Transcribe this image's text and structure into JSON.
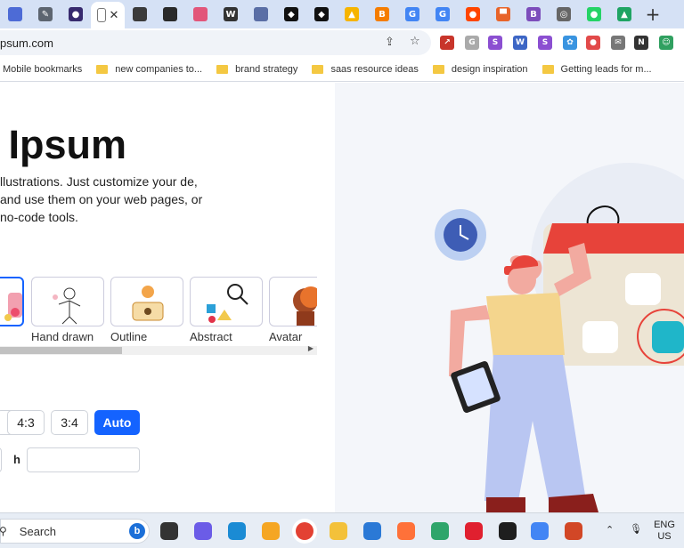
{
  "browser": {
    "tabs": [
      {
        "icon": "profile-icon",
        "color": "#4d6bd6",
        "glyph": ""
      },
      {
        "icon": "feather-icon",
        "color": "#5d6570",
        "glyph": "✎"
      },
      {
        "icon": "circle-avatar-icon",
        "color": "#372a6e",
        "glyph": "●"
      },
      {
        "icon": "doc-icon",
        "color": "#ffffff",
        "glyph": "",
        "active": true
      },
      {
        "icon": "avatar-icon",
        "color": "#3b3b3b",
        "glyph": ""
      },
      {
        "icon": "avatar-icon",
        "color": "#2a2a2a",
        "glyph": ""
      },
      {
        "icon": "monster-icon",
        "color": "#e2567a",
        "glyph": ""
      },
      {
        "icon": "wix-icon",
        "color": "#333333",
        "glyph": "W"
      },
      {
        "icon": "printer-icon",
        "color": "#5a6ea5",
        "glyph": ""
      },
      {
        "icon": "diamond-icon",
        "color": "#111111",
        "glyph": "◆"
      },
      {
        "icon": "diamond-icon",
        "color": "#111111",
        "glyph": "◆"
      },
      {
        "icon": "google-ads-icon",
        "color": "#f6b400",
        "glyph": "▲"
      },
      {
        "icon": "blogger-icon",
        "color": "#f57d00",
        "glyph": "B"
      },
      {
        "icon": "google-icon",
        "color": "#4285f4",
        "glyph": "G"
      },
      {
        "icon": "google-icon",
        "color": "#4285f4",
        "glyph": "G"
      },
      {
        "icon": "reddit-icon",
        "color": "#ff4500",
        "glyph": "●"
      },
      {
        "icon": "bookmark-orange-icon",
        "color": "#e8642a",
        "glyph": "▀"
      },
      {
        "icon": "bolt-icon",
        "color": "#7c4dbb",
        "glyph": "B"
      },
      {
        "icon": "chrome-icon",
        "color": "#666666",
        "glyph": "◎"
      },
      {
        "icon": "whatsapp-icon",
        "color": "#25d366",
        "glyph": "●"
      },
      {
        "icon": "drive-icon",
        "color": "#1fa463",
        "glyph": "▲"
      }
    ],
    "tab_close": "✕",
    "new_tab": "+",
    "url": "psum.com",
    "bookmarks": [
      {
        "label": "Mobile bookmarks",
        "folder": false
      },
      {
        "label": "new companies to...",
        "folder": true
      },
      {
        "label": "brand strategy",
        "folder": true
      },
      {
        "label": "saas resource ideas",
        "folder": true
      },
      {
        "label": "design inspiration",
        "folder": true
      },
      {
        "label": "Getting leads for m...",
        "folder": true
      }
    ],
    "extensions": [
      {
        "name": "arrow-extension-icon",
        "color": "#c8352b",
        "glyph": "↗"
      },
      {
        "name": "grammar-extension-icon",
        "color": "#aaaaaa",
        "glyph": "G"
      },
      {
        "name": "s-extension-icon",
        "color": "#8b4fd1",
        "glyph": "S"
      },
      {
        "name": "wave-extension-icon",
        "color": "#3d66c5",
        "glyph": "W"
      },
      {
        "name": "s-badge-extension-icon",
        "color": "#8b4fd1",
        "glyph": "S"
      },
      {
        "name": "color-picker-extension-icon",
        "color": "#3a94e0",
        "glyph": "✿"
      },
      {
        "name": "pie-extension-icon",
        "color": "#e24a4a",
        "glyph": "●"
      },
      {
        "name": "mail-extension-icon",
        "color": "#777777",
        "glyph": "✉"
      },
      {
        "name": "new-extension-icon",
        "color": "#333333",
        "glyph": "N"
      },
      {
        "name": "robot-extension-icon",
        "color": "#30a060",
        "glyph": "☺"
      }
    ]
  },
  "page": {
    "title": "e Ipsum",
    "description": "llustrations. Just customize your de, and use them on your web pages, or no-code tools.",
    "styles": [
      {
        "label": "Hand drawn"
      },
      {
        "label": "Outline"
      },
      {
        "label": "Abstract"
      },
      {
        "label": "Avatar"
      }
    ],
    "ratios": [
      "4:3",
      "3:4",
      "Auto"
    ],
    "selected_ratio": "Auto",
    "height_label": "h",
    "width_value": "",
    "height_value": ""
  },
  "taskbar": {
    "search_placeholder": "Search",
    "lang": "ENG",
    "region": "US",
    "apps": [
      {
        "name": "taskview-icon",
        "color": "#333333"
      },
      {
        "name": "meet-icon",
        "color": "#6b5ce7"
      },
      {
        "name": "edge-icon",
        "color": "#1b8bd4"
      },
      {
        "name": "norton-icon",
        "color": "#f5a623"
      },
      {
        "name": "chrome-icon",
        "color": "#e34133"
      },
      {
        "name": "explorer-icon",
        "color": "#f3c13a"
      },
      {
        "name": "store-icon",
        "color": "#2b79d6"
      },
      {
        "name": "firefox-icon",
        "color": "#ff7139"
      },
      {
        "name": "edge-dev-icon",
        "color": "#2fa56b"
      },
      {
        "name": "opera-icon",
        "color": "#e0202f"
      },
      {
        "name": "figma-icon",
        "color": "#1e1e1e"
      },
      {
        "name": "chrome-alt-icon",
        "color": "#4285f4"
      },
      {
        "name": "powerpoint-icon",
        "color": "#d24726"
      }
    ]
  }
}
